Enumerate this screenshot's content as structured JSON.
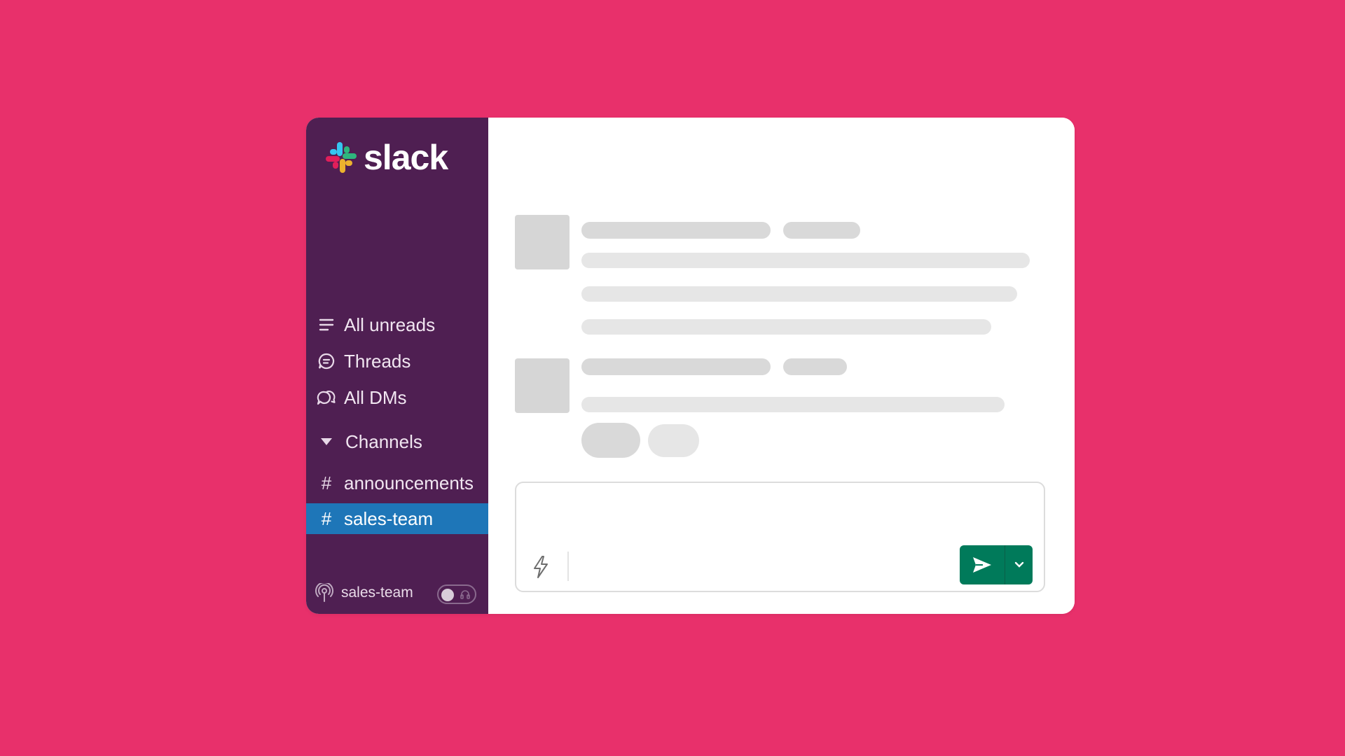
{
  "app": {
    "logo_text": "slack",
    "colors": {
      "background": "#E8306B",
      "sidebar": "#4F1F52",
      "selected": "#1E76B8",
      "send": "#007A5A"
    }
  },
  "sidebar": {
    "nav": [
      {
        "label": "All unreads",
        "icon": "list-icon"
      },
      {
        "label": "Threads",
        "icon": "threads-icon"
      },
      {
        "label": "All DMs",
        "icon": "dms-icon"
      }
    ],
    "section_label": "Channels",
    "channels": [
      {
        "label": "announcements",
        "selected": false
      },
      {
        "label": "sales-team",
        "selected": true
      }
    ],
    "footer": {
      "huddle_channel": "sales-team",
      "toggle": "off"
    }
  },
  "composer": {
    "icons": [
      "lightning-icon",
      "send-icon",
      "chevron-down-icon"
    ]
  }
}
